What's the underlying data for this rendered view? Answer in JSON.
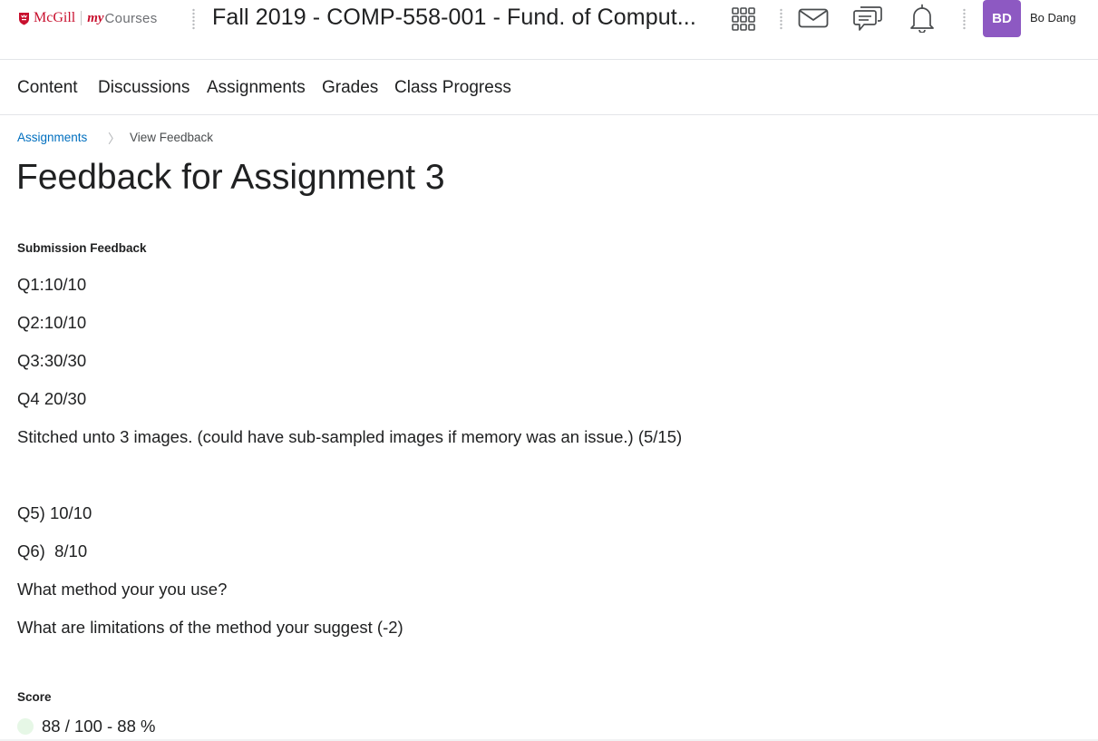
{
  "header": {
    "logo": {
      "brand": "McGill",
      "product_prefix": "my",
      "product_suffix": "Courses"
    },
    "course_title": "Fall 2019 - COMP-558-001 - Fund. of Comput...",
    "icons": [
      "apps-grid-icon",
      "mail-icon",
      "chat-icon",
      "bell-icon"
    ],
    "user": {
      "initials": "BD",
      "name": "Bo Dang",
      "avatar_color": "#8d59c2"
    }
  },
  "nav": {
    "items": [
      "Content",
      "Discussions",
      "Assignments",
      "Grades",
      "Class Progress"
    ]
  },
  "breadcrumb": {
    "parent": "Assignments",
    "current": "View Feedback"
  },
  "page": {
    "title": "Feedback for Assignment 3"
  },
  "feedback": {
    "label": "Submission Feedback",
    "lines": [
      "Q1:10/10",
      "Q2:10/10",
      "Q3:30/30",
      "Q4 20/30",
      "Stitched unto 3 images. (could have sub-sampled images if memory was an issue.) (5/15)",
      "Q5) 10/10",
      "Q6)  8/10",
      "What method your you use?",
      "What are limitations of the method your suggest (-2)"
    ]
  },
  "score": {
    "label": "Score",
    "value": "88 / 100 - 88 %"
  },
  "colors": {
    "brand_red": "#c8102e",
    "link_blue": "#006fbf",
    "avatar_purple": "#8d59c2"
  }
}
